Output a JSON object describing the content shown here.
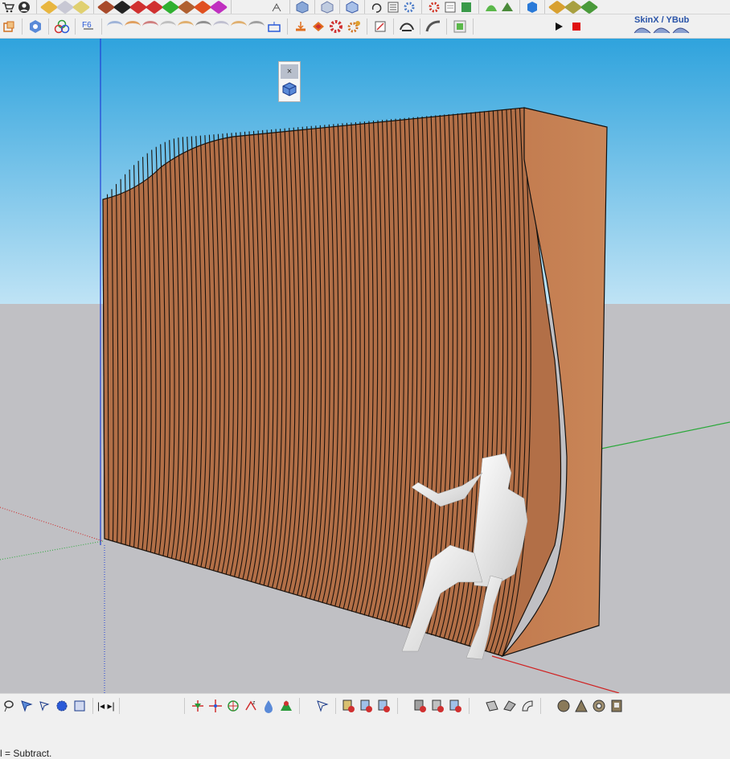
{
  "toolbar": {
    "skinx_label": "SkinX / YBub"
  },
  "float_panel": {
    "close_glyph": "×"
  },
  "bottom_toolbar": {
    "arrows_label": "|◂ ▸|"
  },
  "status": {
    "text": "l = Subtract."
  },
  "colors": {
    "sky_top": "#2fa3dd",
    "sky_bottom": "#bfe3f5",
    "ground": "#c0c0c4",
    "wood": "#b26f47",
    "wood_light": "#c98658",
    "slat_line": "#1a120c",
    "axis_blue": "#1f3fd6",
    "axis_green": "#2aa83a",
    "axis_red": "#d02020"
  },
  "icons": [
    "cart-icon",
    "user-icon",
    "component-cube-icon",
    "push-pull-icon",
    "solid-tools-icon",
    "fredo-scale-icon",
    "curviloft-icon",
    "skin-icon",
    "extrusion-icon",
    "section-icon",
    "gear-icon",
    "sketchy-icon",
    "dimension-icon",
    "layer-icon",
    "profile-builder-icon",
    "outliner-icon",
    "material-icon",
    "sandbox-icon",
    "vertex-tools-icon",
    "play-icon",
    "record-icon"
  ]
}
